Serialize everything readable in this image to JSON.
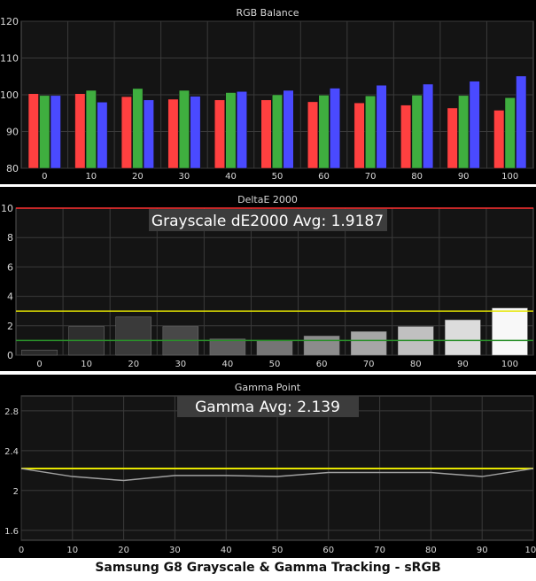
{
  "caption": "Samsung G8 Grayscale & Gamma Tracking - sRGB",
  "colors": {
    "panel_bg": "#000000",
    "plot_bg": "#141414",
    "grid": "#3a3a3a",
    "text": "#d8d8d8",
    "red": "#ff4040",
    "green": "#3fae3f",
    "blue": "#4a4aff",
    "limit_red": "#ff3030",
    "limit_yellow": "#e6e600",
    "limit_green": "#2a8f2a",
    "gamma_line": "#a0a0a0",
    "banner_bg": "#3c3c3c",
    "banner_text": "#ffffff"
  },
  "chart_data": [
    {
      "type": "bar",
      "title": "RGB Balance",
      "categories": [
        "0",
        "10",
        "20",
        "30",
        "40",
        "50",
        "60",
        "70",
        "80",
        "90",
        "100"
      ],
      "series": [
        {
          "color": "red",
          "values": [
            100.3,
            100.3,
            99.5,
            98.8,
            98.6,
            98.6,
            98.1,
            97.8,
            97.2,
            96.4,
            95.8
          ]
        },
        {
          "color": "green",
          "values": [
            99.8,
            101.2,
            101.7,
            101.2,
            100.6,
            100.0,
            99.9,
            99.7,
            99.9,
            99.8,
            99.2
          ]
        },
        {
          "color": "blue",
          "values": [
            99.8,
            98.0,
            98.6,
            99.6,
            100.9,
            101.2,
            101.8,
            102.6,
            102.9,
            103.7,
            105.1
          ]
        }
      ],
      "ylim": [
        80,
        120
      ],
      "yticks": [
        "80",
        "90",
        "100",
        "110",
        "120"
      ],
      "grid": true
    },
    {
      "type": "bar",
      "title": "DeltaE 2000",
      "banner": "Grayscale dE2000 Avg: 1.9187",
      "categories": [
        "0",
        "10",
        "20",
        "30",
        "40",
        "50",
        "60",
        "70",
        "80",
        "90",
        "100"
      ],
      "values": [
        0.35,
        1.95,
        2.6,
        1.95,
        1.1,
        0.95,
        1.3,
        1.6,
        1.95,
        2.4,
        3.2
      ],
      "bar_shades": [
        "#2a2a2a",
        "#2e2e2e",
        "#3a3a3a",
        "#484848",
        "#5e5e5e",
        "#757575",
        "#8c8c8c",
        "#a6a6a6",
        "#c0c0c0",
        "#dcdcdc",
        "#f8f8f8"
      ],
      "reference_lines": [
        {
          "value": 10,
          "color": "limit_red"
        },
        {
          "value": 3,
          "color": "limit_yellow"
        },
        {
          "value": 1,
          "color": "limit_green"
        }
      ],
      "ylim": [
        0,
        10
      ],
      "yticks": [
        "0",
        "2",
        "4",
        "6",
        "8",
        "10"
      ],
      "grid": true
    },
    {
      "type": "line",
      "title": "Gamma Point",
      "banner": "Gamma Avg: 2.139",
      "x": [
        0,
        10,
        20,
        30,
        40,
        50,
        60,
        70,
        80,
        90,
        100
      ],
      "xticks": [
        "0",
        "10",
        "20",
        "30",
        "40",
        "50",
        "60",
        "70",
        "80",
        "90",
        "100"
      ],
      "values": [
        2.22,
        2.14,
        2.1,
        2.15,
        2.15,
        2.14,
        2.18,
        2.18,
        2.18,
        2.14,
        2.22
      ],
      "target": 2.22,
      "target_color": "limit_yellow",
      "line_color": "gamma_line",
      "ylim": [
        1.5,
        2.95
      ],
      "yticks": [
        1.6,
        2.0,
        2.4,
        2.8
      ],
      "ytick_labels": [
        "1.6",
        "2",
        "2.4",
        "2.8"
      ],
      "grid": true
    }
  ]
}
